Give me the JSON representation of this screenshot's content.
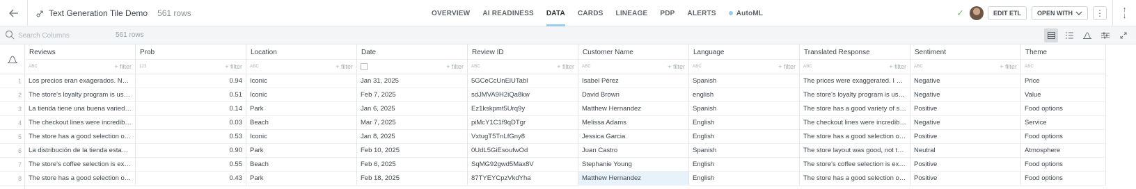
{
  "header": {
    "title": "Text Generation Tile Demo",
    "rows": "561 rows",
    "tabs": [
      "OVERVIEW",
      "AI READINESS",
      "DATA",
      "CARDS",
      "LINEAGE",
      "PDP",
      "ALERTS",
      "AutoML"
    ],
    "active_tab": "DATA",
    "edit_etl": "EDIT ETL",
    "open_with": "OPEN WITH",
    "accent": "#99ccee"
  },
  "toolbar": {
    "search_placeholder": "Search Columns",
    "rows": "561 rows"
  },
  "table": {
    "columns": [
      {
        "name": "Reviews",
        "type": "ABC",
        "filter": "+ filter"
      },
      {
        "name": "Prob",
        "type": "123",
        "filter": "+ filter"
      },
      {
        "name": "Location",
        "type": "ABC",
        "filter": "+ filter"
      },
      {
        "name": "Date",
        "type": "date",
        "filter": "+ filter"
      },
      {
        "name": "Review ID",
        "type": "ABC",
        "filter": "+ filter"
      },
      {
        "name": "Customer Name",
        "type": "ABC",
        "filter": "+ filter"
      },
      {
        "name": "Language",
        "type": "ABC",
        "filter": "+ filter"
      },
      {
        "name": "Translated Response",
        "type": "ABC",
        "filter": "+ filter"
      },
      {
        "name": "Sentiment",
        "type": "ABC",
        "filter": "+ filter"
      },
      {
        "name": "Theme",
        "type": "ABC",
        "filter": ""
      }
    ],
    "row_numbers": [
      "1",
      "2",
      "3",
      "4",
      "5",
      "6",
      "7",
      "8"
    ],
    "rows": [
      [
        "Los precios eran exagerados. No volver...",
        "0.94",
        "Iconic",
        "Jan 31, 2025",
        "5GCeCcUnElUTabl",
        "Isabel Pérez",
        "Spanish",
        "The prices were exaggerated. I will not ...",
        "Negative",
        "Price"
      ],
      [
        "The store's loyalty program is useless. It...",
        "0.51",
        "Iconic",
        "Feb 7, 2025",
        "sdJMVA9H2iQa8kw",
        "David Brown",
        "english",
        "The store's loyalty program is useless. It...",
        "Negative",
        "Value"
      ],
      [
        "La tienda tiene una buena variedad de ...",
        "0.14",
        "Park",
        "Jan 6, 2025",
        "Ez1kskpmt5Urq9y",
        "Matthew Hernandez",
        "Spanish",
        "The store has a good variety of snacks a...",
        "Positive",
        "Food options"
      ],
      [
        "The checkout lines were incredibly slow,...",
        "0.03",
        "Beach",
        "Mar 7, 2025",
        "piMcY1C1f9qDTgr",
        "Melissa Adams",
        "English",
        "The checkout lines were incredibly slow,...",
        "Negative",
        "Service"
      ],
      [
        "The store has a good selection of eggs a...",
        "0.53",
        "Iconic",
        "Jan 8, 2025",
        "VxtugT5TnLfGny8",
        "Jessica Garcia",
        "English",
        "The store has a good selection of eggs a...",
        "Positive",
        "Food options"
      ],
      [
        "La distribución de la tienda estaba bien,...",
        "0.90",
        "Park",
        "Feb 10, 2025",
        "0UdL5GiEsoufwOd",
        "Juan Castro",
        "Spanish",
        "The store layout was good, not the best,...",
        "Neutral",
        "Atmosphere"
      ],
      [
        "The store's coffee selection is excellent, ...",
        "0.55",
        "Beach",
        "Feb 6, 2025",
        "SqMG92gwd5Max8V",
        "Stephanie Young",
        "English",
        "The store's coffee selection is excellent, ...",
        "Positive",
        "Food options"
      ],
      [
        "The store has a good selection of sauces.",
        "0.43",
        "Park",
        "Feb 18, 2025",
        "87TYEYCpzVkdYha",
        "Matthew Hernandez",
        "English",
        "The store has a good selection of sauces.",
        "Positive",
        "Food options"
      ]
    ]
  }
}
